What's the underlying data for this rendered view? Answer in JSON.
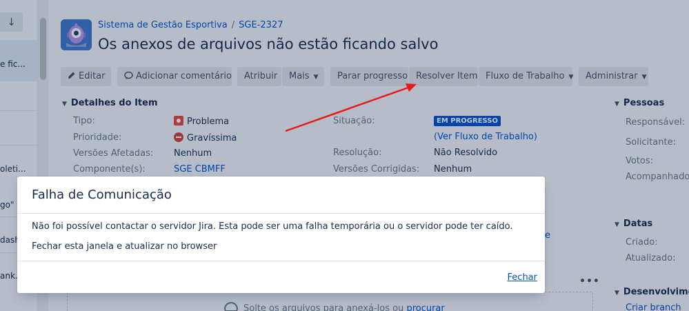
{
  "sidebar": {
    "items": [
      {
        "label": "e fic..."
      },
      {
        "label": "oleti..."
      },
      {
        "label": "go\""
      },
      {
        "label": "dash..."
      },
      {
        "label": "ank..."
      }
    ]
  },
  "header": {
    "breadcrumb_project": "Sistema de Gestão Esportiva",
    "breadcrumb_separator": "/",
    "breadcrumb_issue": "SGE-2327",
    "title": "Os anexos de arquivos não estão ficando salvo"
  },
  "toolbar": {
    "edit": "Editar",
    "comment": "Adicionar comentário",
    "assign": "Atribuir",
    "more": "Mais",
    "stop_progress": "Parar progresso",
    "resolve": "Resolver Item",
    "workflow": "Fluxo de Trabalho",
    "admin": "Administrar"
  },
  "details": {
    "heading": "Detalhes do Item",
    "type_label": "Tipo:",
    "type_value": "Problema",
    "priority_label": "Prioridade:",
    "priority_value": "Gravíssima",
    "affects_label": "Versões Afetadas:",
    "affects_value": "Nenhum",
    "component_label": "Componente(s):",
    "component_value": "SGE CBMFF",
    "status_label": "Situação:",
    "status_value": "EM PROGRESSO",
    "workflow_link": "(Ver Fluxo de Trabalho)",
    "resolution_label": "Resolução:",
    "resolution_value": "Não Resolvido",
    "fix_label": "Versões Corrigidas:",
    "fix_value": "Nenhum",
    "partial_char": "e"
  },
  "people": {
    "heading": "Pessoas",
    "assignee_label": "Responsável:",
    "reporter_label": "Solicitante:",
    "votes_label": "Votos:",
    "watchers_label": "Acompanhadores:"
  },
  "dates": {
    "heading": "Datas",
    "created_label": "Criado:",
    "updated_label": "Atualizado:"
  },
  "development": {
    "heading": "Desenvolvimento",
    "create_branch": "Criar branch"
  },
  "attachments": {
    "more": "•••",
    "drop_text": "Solte os arquivos para anexá-los ou",
    "browse": "procurar"
  },
  "modal": {
    "title": "Falha de Comunicação",
    "message": "Não foi possível contactar o servidor Jira. Esta pode ser uma falha temporária ou o servidor pode ter caído.",
    "hint": "Fechar esta janela e atualizar no browser",
    "close": "Fechar"
  },
  "colors": {
    "annotation_arrow": "#e8191c",
    "link": "#0052cc",
    "status_lozenge": "#0052cc"
  }
}
